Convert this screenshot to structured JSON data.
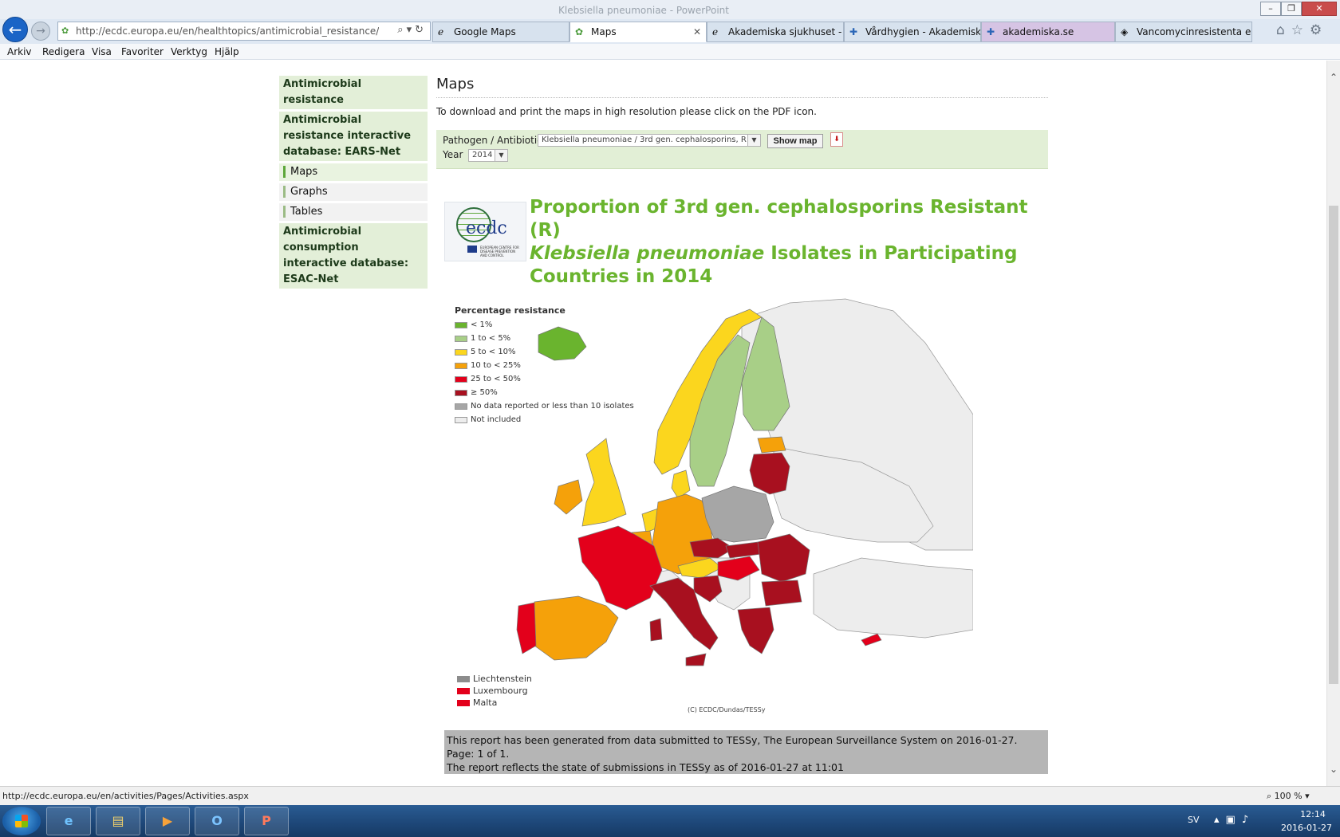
{
  "browser": {
    "window_title": "Klebsiella pneumoniae - PowerPoint",
    "address_url": "http://ecdc.europa.eu/en/healthtopics/antimicrobial_resistance/database",
    "tabs": [
      {
        "label": "Google Maps",
        "active": false
      },
      {
        "label": "Maps",
        "active": true
      },
      {
        "label": "Akademiska sjukhuset - L...",
        "active": false
      },
      {
        "label": "Vårdhygien - Akademisk...",
        "active": false
      },
      {
        "label": "akademiska.se",
        "active": false
      },
      {
        "label": "Vancomycinresistenta en...",
        "active": false
      }
    ],
    "tab_close": "✕",
    "menu": [
      "Arkiv",
      "Redigera",
      "Visa",
      "Favoriter",
      "Verktyg",
      "Hjälp"
    ],
    "status_url": "http://ecdc.europa.eu/en/activities/Pages/Activities.aspx",
    "zoom": "100 %"
  },
  "sidebar": {
    "sections": [
      {
        "label": "Antimicrobial resistance",
        "type": "header"
      },
      {
        "label": "Antimicrobial resistance interactive database: EARS-Net",
        "type": "header"
      },
      {
        "label": "Maps",
        "type": "item",
        "current": true
      },
      {
        "label": "Graphs",
        "type": "item",
        "current": false
      },
      {
        "label": "Tables",
        "type": "item",
        "current": false
      },
      {
        "label": "Antimicrobial consumption interactive database: ESAC-Net",
        "type": "header"
      }
    ]
  },
  "main": {
    "heading": "Maps",
    "download_note": "To download and print the maps in high resolution please click on the PDF icon.",
    "form": {
      "pathogen_label": "Pathogen / Antibiotic",
      "pathogen_value": "Klebsiella pneumoniae / 3rd gen. cephalosporins, R",
      "year_label": "Year",
      "year_value": "2014",
      "show_map_label": "Show map",
      "pdf_icon": "pdf-icon"
    },
    "map_title_line1": "Proportion of 3rd gen. cephalosporins Resistant (R)",
    "map_title_species": "Klebsiella pneumoniae",
    "map_title_rest": " Isolates in Participating Countries in 2014",
    "logo_text": "ecdc",
    "logo_small": "EUROPEAN CENTRE FOR DISEASE PREVENTION AND CONTROL",
    "legend": {
      "title": "Percentage resistance",
      "items": [
        {
          "label": "< 1%",
          "color": "#6ab42e"
        },
        {
          "label": "1 to < 5%",
          "color": "#a8cf87"
        },
        {
          "label": "5 to < 10%",
          "color": "#fbd61e"
        },
        {
          "label": "10 to < 25%",
          "color": "#f5a10a"
        },
        {
          "label": "25 to < 50%",
          "color": "#e3001b"
        },
        {
          "label": "≥ 50%",
          "color": "#a8101f"
        },
        {
          "label": "No data reported or less than 10 isolates",
          "color": "#a6a6a6"
        },
        {
          "label": "Not included",
          "color": "#ededed"
        }
      ]
    },
    "small_countries": [
      {
        "label": "Liechtenstein",
        "color": "#8c8c8c"
      },
      {
        "label": "Luxembourg",
        "color": "#e3001b"
      },
      {
        "label": "Malta",
        "color": "#e3001b"
      }
    ],
    "copyright": "(C) ECDC/Dundas/TESSy",
    "report_line1": "This report has been generated from data submitted to TESSy, The European Surveillance System on 2016-01-27. Page: 1 of 1.",
    "report_line2": "The report reflects the state of submissions in TESSy as of 2016-01-27 at 11:01"
  },
  "taskbar": {
    "apps": [
      "internet-explorer-icon",
      "file-explorer-icon",
      "media-player-icon",
      "outlook-icon",
      "powerpoint-icon"
    ],
    "lang": "SV",
    "time": "12:14",
    "date": "2016-01-27"
  }
}
